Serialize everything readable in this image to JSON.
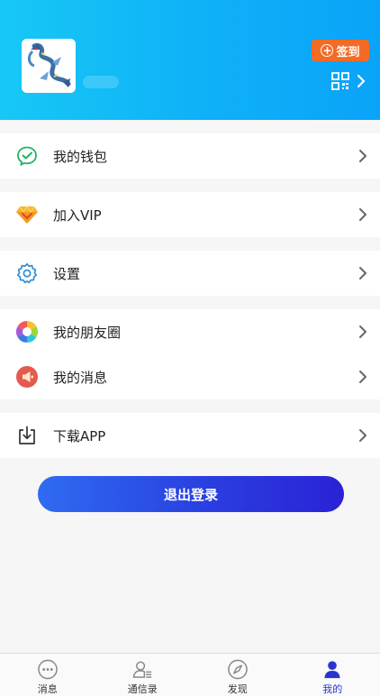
{
  "header": {
    "checkin_label": "签到"
  },
  "menu": {
    "wallet": "我的钱包",
    "vip": "加入VIP",
    "settings": "设置",
    "moments": "我的朋友圈",
    "messages": "我的消息",
    "download": "下载APP"
  },
  "logout_label": "退出登录",
  "tabs": [
    {
      "label": "消息",
      "icon": "chat-bubble-icon"
    },
    {
      "label": "通信录",
      "icon": "contacts-icon"
    },
    {
      "label": "发现",
      "icon": "compass-icon"
    },
    {
      "label": "我的",
      "icon": "person-icon"
    }
  ],
  "colors": {
    "header_start": "#17c8f6",
    "header_end": "#0aa3f9",
    "checkin_bg": "#f46b25",
    "logout_start": "#2f6bf2",
    "logout_end": "#2a22d6",
    "active_tab": "#2b33cf"
  }
}
